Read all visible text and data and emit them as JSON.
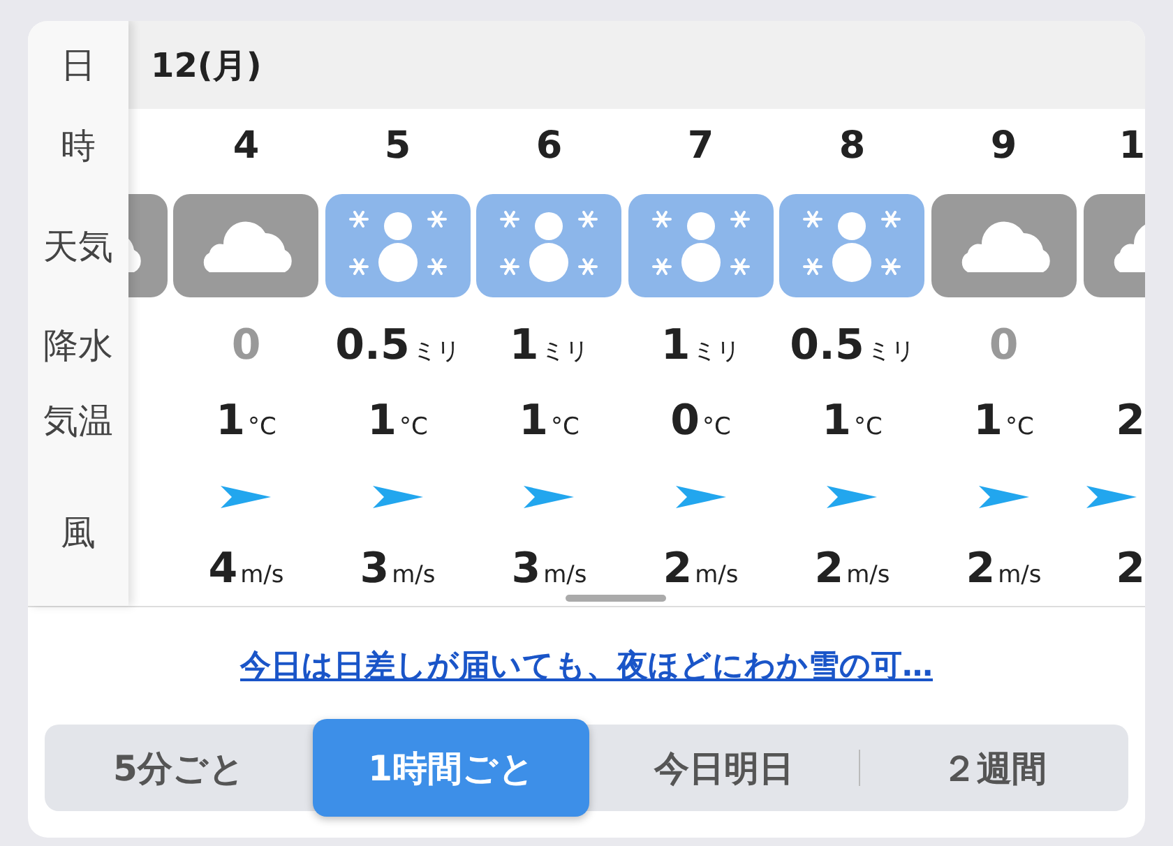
{
  "date_row": {
    "label": "日",
    "date": "12(月)"
  },
  "row_labels": {
    "hour": "時",
    "weather": "天気",
    "precipitation": "降水",
    "temperature": "気温",
    "wind": "風"
  },
  "hours": [
    {
      "kind": "cloudy"
    },
    {
      "hour": "4",
      "kind": "cloudy",
      "precipitation": "0",
      "dry": true,
      "temperature": "1",
      "temperature_unit": "°C",
      "wind": "4",
      "wind_unit": "m/s"
    },
    {
      "hour": "5",
      "kind": "snow",
      "precipitation": "0.5",
      "precipitation_unit": "ミリ",
      "dry": false,
      "temperature": "1",
      "temperature_unit": "°C",
      "wind": "3",
      "wind_unit": "m/s"
    },
    {
      "hour": "6",
      "kind": "snow",
      "precipitation": "1",
      "precipitation_unit": "ミリ",
      "dry": false,
      "temperature": "1",
      "temperature_unit": "°C",
      "wind": "3",
      "wind_unit": "m/s"
    },
    {
      "hour": "7",
      "kind": "snow",
      "precipitation": "1",
      "precipitation_unit": "ミリ",
      "dry": false,
      "temperature": "0",
      "temperature_unit": "°C",
      "wind": "2",
      "wind_unit": "m/s"
    },
    {
      "hour": "8",
      "kind": "snow",
      "precipitation": "0.5",
      "precipitation_unit": "ミリ",
      "dry": false,
      "temperature": "1",
      "temperature_unit": "°C",
      "wind": "2",
      "wind_unit": "m/s"
    },
    {
      "hour": "9",
      "kind": "cloudy",
      "precipitation": "0",
      "dry": true,
      "temperature": "1",
      "temperature_unit": "°C",
      "wind": "2",
      "wind_unit": "m/s"
    },
    {
      "hour": "1",
      "kind": "cloudy",
      "temperature": "2",
      "wind": "2"
    }
  ],
  "summary_link": "今日は日差しが届いても、夜ほどにわか雪の可…",
  "segments": [
    {
      "label": "5分ごと",
      "selected": false
    },
    {
      "label": "1時間ごと",
      "selected": true
    },
    {
      "label": "今日明日",
      "selected": false
    },
    {
      "label": "２週間",
      "selected": false
    }
  ]
}
